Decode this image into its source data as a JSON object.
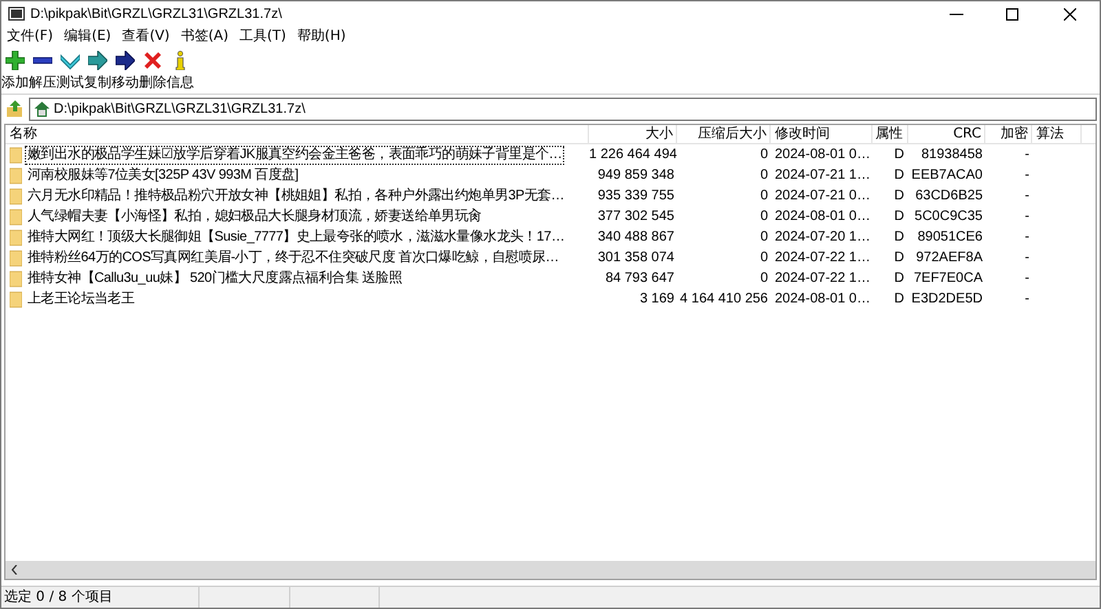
{
  "window": {
    "title": "D:\\pikpak\\Bit\\GRZL\\GRZL31\\GRZL31.7z\\"
  },
  "menu": [
    "文件(F)",
    "编辑(E)",
    "查看(V)",
    "书签(A)",
    "工具(T)",
    "帮助(H)"
  ],
  "toolbar": [
    {
      "kind": "add",
      "label": "添加"
    },
    {
      "kind": "extract",
      "label": "解压"
    },
    {
      "kind": "test",
      "label": "测试"
    },
    {
      "kind": "copy",
      "label": "复制"
    },
    {
      "kind": "move",
      "label": "移动"
    },
    {
      "kind": "delete",
      "label": "删除"
    },
    {
      "kind": "info",
      "label": "信息"
    }
  ],
  "address": "D:\\pikpak\\Bit\\GRZL\\GRZL31\\GRZL31.7z\\",
  "table": {
    "columns": [
      "名称",
      "大小",
      "压缩后大小",
      "修改时间",
      "属性",
      "CRC",
      "加密",
      "算法"
    ],
    "rows": [
      {
        "focused": true,
        "cells": [
          "嫩到出水的极品学生妹☑放学后穿着JK服真空约会金主爸爸，表面乖巧的萌妹子背里是个…",
          "1 226 464 494",
          "0",
          "2024-08-01 0…",
          "D",
          "81938458",
          "-",
          ""
        ]
      },
      {
        "focused": false,
        "cells": [
          "河南校服妹等7位美女[325P 43V 993M 百度盘]",
          "949 859 348",
          "0",
          "2024-07-21 1…",
          "D",
          "EEB7ACA0",
          "-",
          ""
        ]
      },
      {
        "focused": false,
        "cells": [
          "六月无水印精品！推特极品粉穴开放女神【桃姐姐】私拍，各种户外露出约炮单男3P无套…",
          "935 339 755",
          "0",
          "2024-07-21 0…",
          "D",
          "63CD6B25",
          "-",
          ""
        ]
      },
      {
        "focused": false,
        "cells": [
          "人气绿帽夫妻【小海怪】私拍，媳妇极品大长腿身材顶流，娇妻送给单男玩肏",
          "377 302 545",
          "0",
          "2024-08-01 0…",
          "D",
          "5C0C9C35",
          "-",
          ""
        ]
      },
      {
        "focused": false,
        "cells": [
          "推特大网红！顶级大长腿御姐【Susie_7777】史上最夸张的喷水，滋滋水量像水龙头！17…",
          "340 488 867",
          "0",
          "2024-07-20 1…",
          "D",
          "89051CE6",
          "-",
          ""
        ]
      },
      {
        "focused": false,
        "cells": [
          "推特粉丝64万的COS写真网红美眉-小丁，终于忍不住突破尺度 首次口爆吃鲸，自慰喷尿…",
          "301 358 074",
          "0",
          "2024-07-22 1…",
          "D",
          "972AEF8A",
          "-",
          ""
        ]
      },
      {
        "focused": false,
        "cells": [
          "推特女神【Callu3u_uu妹】 520门槛大尺度露点福利合集 送脸照",
          "84 793 647",
          "0",
          "2024-07-22 1…",
          "D",
          "7EF7E0CA",
          "-",
          ""
        ]
      },
      {
        "focused": false,
        "cells": [
          "上老王论坛当老王",
          "3 169",
          "4 164 410 256",
          "2024-08-01 0…",
          "D",
          "E3D2DE5D",
          "-",
          ""
        ]
      }
    ]
  },
  "status_bar": "选定 0 / 8 个项目"
}
